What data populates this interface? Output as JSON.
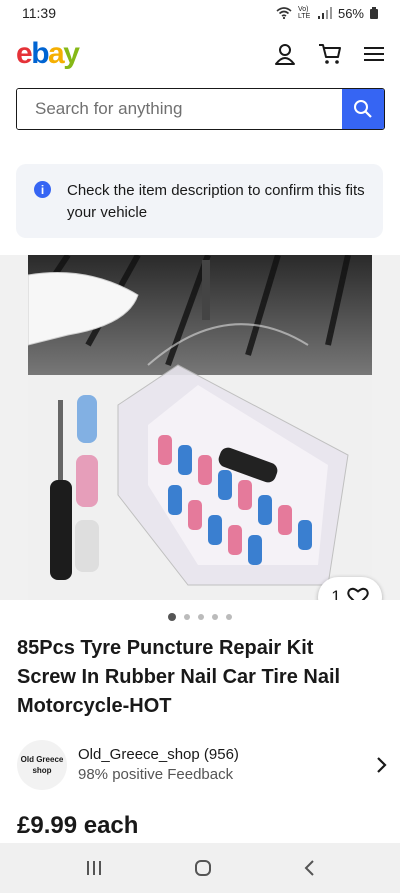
{
  "status": {
    "time": "11:39",
    "battery": "56%",
    "network": "Vo) LTE"
  },
  "header": {
    "logo": {
      "e": "e",
      "b": "b",
      "a": "a",
      "y": "y"
    }
  },
  "search": {
    "placeholder": "Search for anything"
  },
  "notice": {
    "text": "Check the item description to confirm this fits your vehicle"
  },
  "gallery": {
    "like_count": "1",
    "image_count": 5,
    "active_index": 0
  },
  "item": {
    "title": "85Pcs Tyre Puncture Repair Kit Screw In Rubber Nail Car Tire Nail Motorcycle-HOT",
    "price": "£9.99 each"
  },
  "seller": {
    "avatar_text": "Old Greece shop",
    "name": "Old_Greece_shop (956)",
    "feedback": "98% positive Feedback"
  },
  "colors": {
    "ebay_blue": "#3665f3",
    "notice_bg": "#f2f4f8",
    "logo_red": "#e53238",
    "logo_blue": "#0064d2",
    "logo_yellow": "#f5af02",
    "logo_green": "#86b817"
  }
}
